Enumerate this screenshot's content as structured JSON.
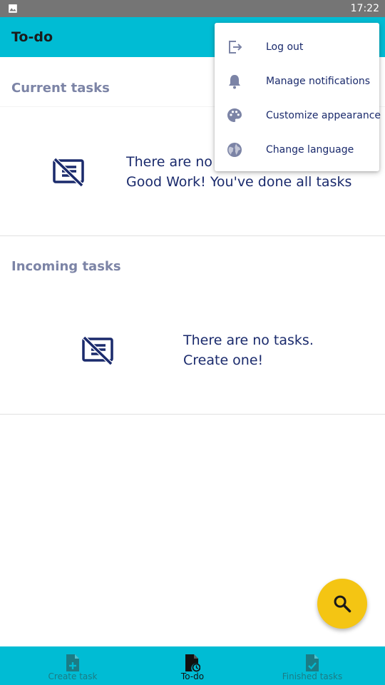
{
  "status_bar": {
    "time": "17:22",
    "notification_icon": "image-icon"
  },
  "app_bar": {
    "title": "To-do"
  },
  "current_section": {
    "title": "Current tasks",
    "empty_line1": "There are no tasks.",
    "empty_line2": "Good Work! You've done all tasks",
    "icon": "no-tasks-icon"
  },
  "incoming_section": {
    "title": "Incoming tasks",
    "empty_line1": "There are no tasks.",
    "empty_line2": "Create one!",
    "icon": "no-tasks-icon"
  },
  "fab": {
    "icon": "search-icon"
  },
  "bottom_nav": {
    "items": [
      {
        "label": "Create task",
        "icon": "note-add-icon",
        "active": false
      },
      {
        "label": "To-do",
        "icon": "note-clock-icon",
        "active": true
      },
      {
        "label": "Finished tasks",
        "icon": "note-check-icon",
        "active": false
      }
    ]
  },
  "menu": {
    "items": [
      {
        "label": "Log out",
        "icon": "logout-icon"
      },
      {
        "label": "Manage notifications",
        "icon": "bell-icon"
      },
      {
        "label": "Customize appearance",
        "icon": "palette-icon"
      },
      {
        "label": "Change language",
        "icon": "globe-icon"
      }
    ]
  },
  "colors": {
    "primary": "#00bcd4",
    "accent": "#f4c513",
    "text_dark_blue": "#1a2a6c",
    "section_title": "#7c84a6",
    "status_bar": "#757575"
  }
}
